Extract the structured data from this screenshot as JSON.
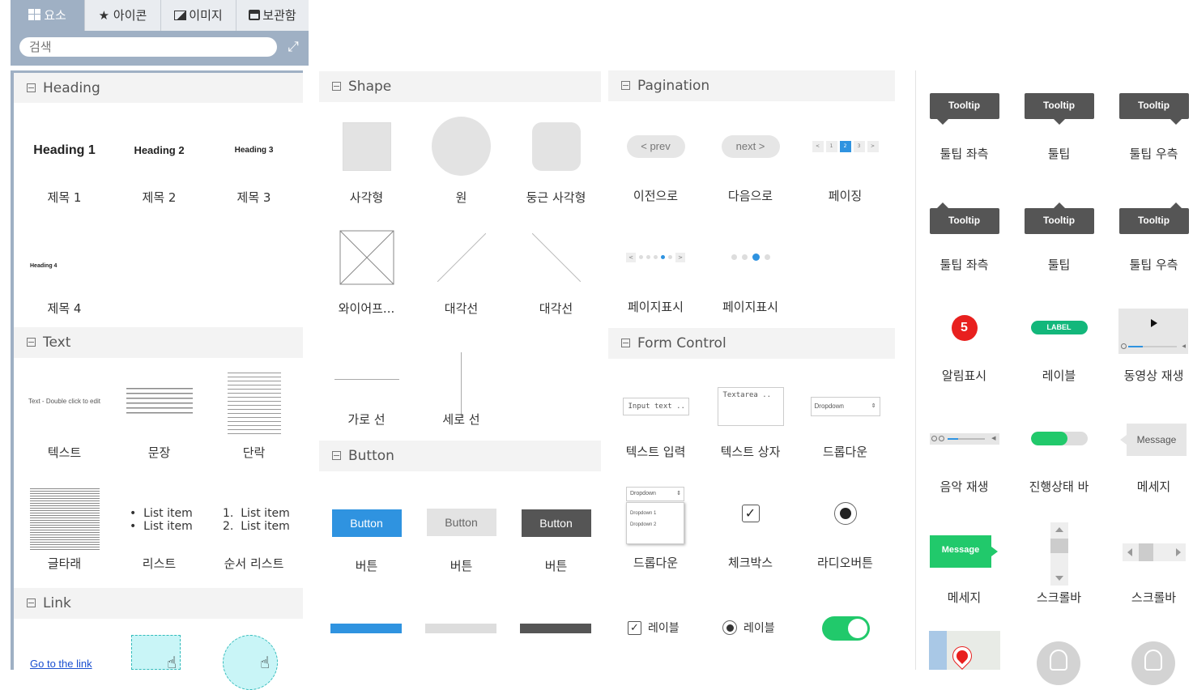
{
  "tabs": [
    {
      "label": "요소",
      "icon": "grid-icon"
    },
    {
      "label": "아이콘",
      "icon": "star-icon"
    },
    {
      "label": "이미지",
      "icon": "image-icon"
    },
    {
      "label": "보관함",
      "icon": "archive-icon"
    }
  ],
  "search": {
    "placeholder": "검색"
  },
  "sections": {
    "heading": "Heading",
    "text": "Text",
    "link": "Link",
    "shape": "Shape",
    "button": "Button",
    "pagination": "Pagination",
    "form": "Form Control"
  },
  "heading_items": [
    {
      "preview": "Heading 1",
      "label": "제목 1"
    },
    {
      "preview": "Heading 2",
      "label": "제목 2"
    },
    {
      "preview": "Heading 3",
      "label": "제목 3"
    },
    {
      "preview": "Heading 4",
      "label": "제목 4"
    }
  ],
  "text_items": {
    "text_preview": "Text - Double click to edit",
    "labels": [
      "텍스트",
      "문장",
      "단락",
      "글타래",
      "리스트",
      "순서 리스트"
    ],
    "list": [
      "List item",
      "List item"
    ],
    "olist": [
      "1.  List item",
      "2.  List item"
    ]
  },
  "link_items": {
    "preview": "Go to the link"
  },
  "shape_items": {
    "labels": [
      "사각형",
      "원",
      "둥근 사각형",
      "와이어프...",
      "대각선",
      "대각선",
      "가로 선",
      "세로 선"
    ]
  },
  "button_items": {
    "preview": "Button",
    "labels": [
      "버튼",
      "버튼",
      "버튼"
    ]
  },
  "pagination_items": {
    "prev": "< prev",
    "next": "next >",
    "pages": [
      "<",
      "1",
      "2",
      "3",
      ">"
    ],
    "labels": [
      "이전으로",
      "다음으로",
      "페이징",
      "페이지표시",
      "페이지표시"
    ]
  },
  "form_items": {
    "input_preview": "Input text ..",
    "textarea_preview": "Textarea ..",
    "dropdown_preview": "Dropdown",
    "dropdown_options": [
      "Dropdown 1",
      "Dropdown 2"
    ],
    "labels": [
      "텍스트 입력",
      "텍스트 상자",
      "드롭다운",
      "드롭다운",
      "체크박스",
      "라디오버튼"
    ],
    "checkbox_label": "레이블",
    "radio_label": "레이블"
  },
  "right_items": {
    "tooltip": "Tooltip",
    "labels": [
      "툴팁 좌측",
      "툴팁",
      "툴팁 우측",
      "툴팁 좌측",
      "툴팁",
      "툴팁 우측",
      "알림표시",
      "레이블",
      "동영상 재생",
      "음악 재생",
      "진행상태 바",
      "메세지",
      "메세지",
      "스크롤바",
      "스크롤바"
    ],
    "badge_count": "5",
    "label_preview": "LABEL",
    "message_preview": "Message",
    "progress_fraction": 0.65
  },
  "colors": {
    "accent": "#2f93e0",
    "green": "#21c96b",
    "badge": "#e8201e",
    "tabbar": "#9fb0c4"
  }
}
